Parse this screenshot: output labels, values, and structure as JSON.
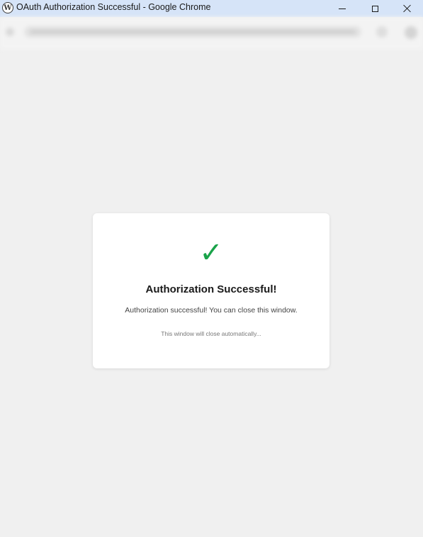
{
  "window": {
    "title": "OAuth Authorization Successful - Google Chrome",
    "app_icon": "wordpress-logo-icon",
    "app_icon_glyph": "W"
  },
  "titlebar_buttons": {
    "minimize_icon": "minimize-icon",
    "maximize_icon": "maximize-icon",
    "close_icon": "close-icon"
  },
  "toolbar": {
    "state": "blurred"
  },
  "card": {
    "icon": "checkmark-icon",
    "check_glyph": "✓",
    "title": "Authorization Successful!",
    "message": "Authorization successful! You can close this window.",
    "note": "This window will close automatically..."
  },
  "colors": {
    "titlebar": "#d6e4f8",
    "page_background": "#f0f0f0",
    "card_background": "#ffffff",
    "success_green": "#1aa34a"
  }
}
